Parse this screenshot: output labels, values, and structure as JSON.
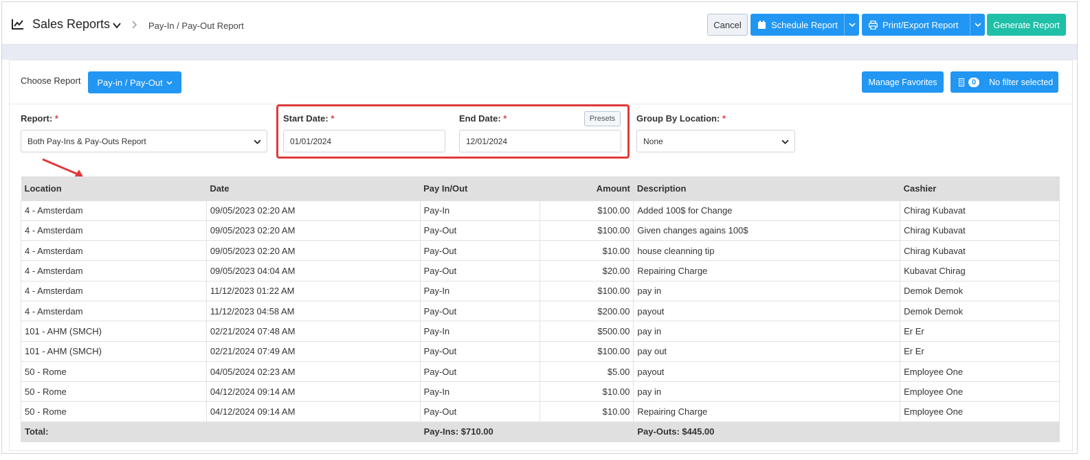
{
  "header": {
    "title": "Sales Reports",
    "breadcrumb": "Pay-In / Pay-Out Report",
    "buttons": {
      "cancel": "Cancel",
      "schedule": "Schedule Report",
      "print": "Print/Export Report",
      "generate": "Generate Report"
    }
  },
  "toolbar": {
    "choose_label": "Choose Report",
    "choose_value": "Pay-in / Pay-Out",
    "manage_favorites": "Manage Favorites",
    "filter_count": "0",
    "filter_label": "No filter selected"
  },
  "filters": {
    "report_label": "Report:",
    "report_value": "Both Pay-Ins & Pay-Outs Report",
    "start_label": "Start Date:",
    "start_value": "01/01/2024",
    "end_label": "End Date:",
    "end_value": "12/01/2024",
    "presets": "Presets",
    "group_label": "Group By Location:",
    "group_value": "None",
    "required_mark": "*"
  },
  "table": {
    "headers": {
      "location": "Location",
      "date": "Date",
      "pay": "Pay In/Out",
      "amount": "Amount",
      "description": "Description",
      "cashier": "Cashier"
    },
    "rows": [
      {
        "location": "4 - Amsterdam",
        "date": "09/05/2023 02:20 AM",
        "pay": "Pay-In",
        "amount": "$100.00",
        "description": "Added 100$ for Change",
        "cashier": "Chirag Kubavat"
      },
      {
        "location": "4 - Amsterdam",
        "date": "09/05/2023 02:20 AM",
        "pay": "Pay-Out",
        "amount": "$100.00",
        "description": "Given changes agains 100$",
        "cashier": "Chirag Kubavat"
      },
      {
        "location": "4 - Amsterdam",
        "date": "09/05/2023 02:20 AM",
        "pay": "Pay-Out",
        "amount": "$10.00",
        "description": "house cleanning tip",
        "cashier": "Chirag Kubavat"
      },
      {
        "location": "4 - Amsterdam",
        "date": "09/05/2023 04:04 AM",
        "pay": "Pay-Out",
        "amount": "$20.00",
        "description": "Repairing Charge",
        "cashier": "Kubavat Chirag"
      },
      {
        "location": "4 - Amsterdam",
        "date": "11/12/2023 01:22 AM",
        "pay": "Pay-In",
        "amount": "$100.00",
        "description": "pay in",
        "cashier": "Demok Demok"
      },
      {
        "location": "4 - Amsterdam",
        "date": "11/12/2023 04:58 AM",
        "pay": "Pay-Out",
        "amount": "$200.00",
        "description": "payout",
        "cashier": "Demok Demok"
      },
      {
        "location": "101 - AHM (SMCH)",
        "date": "02/21/2024 07:48 AM",
        "pay": "Pay-In",
        "amount": "$500.00",
        "description": "pay in",
        "cashier": "Er Er"
      },
      {
        "location": "101 - AHM (SMCH)",
        "date": "02/21/2024 07:49 AM",
        "pay": "Pay-Out",
        "amount": "$100.00",
        "description": "pay out",
        "cashier": "Er Er"
      },
      {
        "location": "50 - Rome",
        "date": "04/05/2024 02:23 AM",
        "pay": "Pay-Out",
        "amount": "$5.00",
        "description": "payout",
        "cashier": "Employee One"
      },
      {
        "location": "50 - Rome",
        "date": "04/12/2024 09:14 AM",
        "pay": "Pay-In",
        "amount": "$10.00",
        "description": " pay in",
        "cashier": "Employee One"
      },
      {
        "location": "50 - Rome",
        "date": "04/12/2024 09:14 AM",
        "pay": "Pay-Out",
        "amount": "$10.00",
        "description": "Repairing Charge",
        "cashier": "Employee One"
      }
    ],
    "total": {
      "label": "Total:",
      "pay_ins": "Pay-Ins: $710.00",
      "pay_outs": "Pay-Outs: $445.00"
    }
  },
  "colors": {
    "primary": "#2196f3",
    "success": "#1fbfa8",
    "highlight": "#e03a3a"
  }
}
